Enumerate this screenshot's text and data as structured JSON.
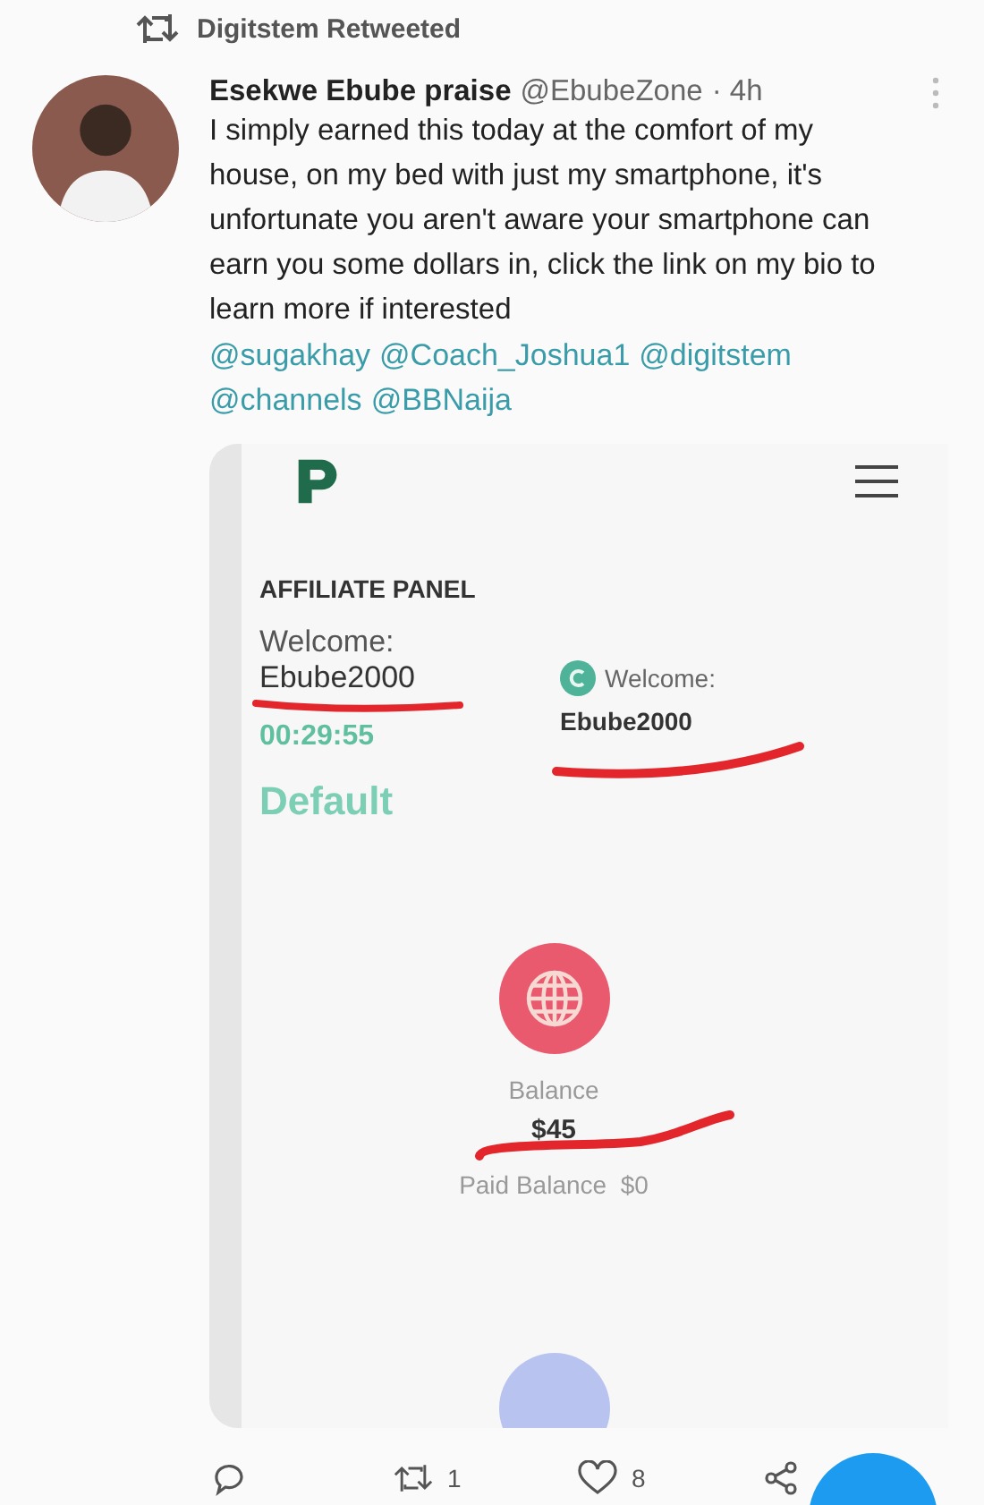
{
  "retweet_banner": "Digitstem Retweeted",
  "tweet": {
    "author": "Esekwe Ebube praise",
    "handle": "@EbubeZone",
    "time": "· 4h",
    "text": "I simply earned this today at the comfort of my house, on my bed with just my smartphone, it's unfortunate you aren't aware your smartphone can earn you some dollars in, click the link on my bio to learn more if interested",
    "mentions": [
      "@sugakhay",
      "@Coach_Joshua1",
      "@digitstem",
      "@channels",
      "@BBNaija"
    ]
  },
  "embedded_screenshot": {
    "panel_title": "AFFILIATE PANEL",
    "welcome_label": "Welcome:",
    "username": "Ebube2000",
    "timer": "00:29:55",
    "plan": "Default",
    "card_welcome_label": "Welcome:",
    "card_username": "Ebube2000",
    "balance_label": "Balance",
    "balance_value": "$45",
    "paid_balance": "Paid Balance  $0"
  },
  "actions": [
    {
      "kind": "reply"
    },
    {
      "kind": "retweet",
      "count": "1"
    },
    {
      "kind": "like",
      "count": "8"
    },
    {
      "kind": "share"
    }
  ]
}
